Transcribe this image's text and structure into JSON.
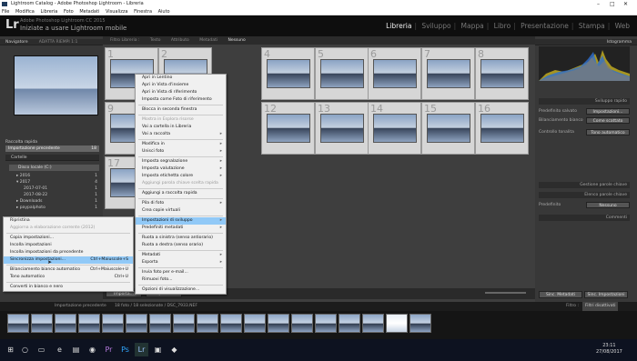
{
  "window": {
    "title": "Lightroom Catalog - Adobe Photoshop Lightroom - Libreria"
  },
  "menubar": [
    "File",
    "Modifica",
    "Libreria",
    "Foto",
    "Metadati",
    "Visualizza",
    "Finestra",
    "Aiuto"
  ],
  "identity": {
    "logo": "Lr",
    "catalog": "Adobe Photoshop Lightroom CC 2015",
    "sync": "Iniziate a usare Lightroom mobile"
  },
  "modules": [
    "Libreria",
    "Sviluppo",
    "Mappa",
    "Libro",
    "Presentazione",
    "Stampa",
    "Web"
  ],
  "left": {
    "navigator": "Navigatore",
    "nav_opts": "ADATTA  RIEMPI  1:1",
    "collection": "Raccolta rapida",
    "import": "Importazione precedente",
    "import_count": "18",
    "catalog": "Cartelle",
    "folders": [
      {
        "name": "2016",
        "count": "1"
      },
      {
        "name": "2017",
        "count": "4"
      },
      {
        "name": "2017-07-01",
        "count": "1"
      },
      {
        "name": "2017-08-22",
        "count": "1"
      },
      {
        "name": "Downloads",
        "count": "1"
      },
      {
        "name": "paypalphoto",
        "count": "1"
      }
    ]
  },
  "filter": {
    "label": "Filtro Libreria :",
    "tabs": [
      "Testo",
      "Attributo",
      "Metadati",
      "Nessuno"
    ]
  },
  "grid": {
    "numbers": [
      "1",
      "2",
      "3",
      "4",
      "5",
      "6",
      "7",
      "8",
      "9",
      "10",
      "11",
      "12",
      "13",
      "14",
      "15",
      "16",
      "17"
    ]
  },
  "context_menu": {
    "items": [
      "Apri in Lentino",
      "Apri in Vista d'insieme",
      "Apri in Vista di riferimento",
      "Imposta come Foto di riferimento",
      "Blocca in seconda finestra",
      "Mostra in Esplora risorse",
      "Vai a cartella in Libreria",
      "Vai a raccolta",
      "Modifica in",
      "Unisci foto",
      "Imposta segnalazione",
      "Imposta valutazione",
      "Imposta etichetta colore",
      "Aggiungi parola chiave scelta rapida",
      "Aggiungi a raccolta rapida",
      "Pila di foto",
      "Crea copie virtuali",
      "Impostazioni di sviluppo",
      "Predefiniti metadati",
      "Ruota a sinistra (senso antiorario)",
      "Ruota a destra (senso orario)",
      "Metadati",
      "Esporta",
      "Invia foto per e-mail...",
      "Rimuovi foto...",
      "Opzioni di visualizzazione..."
    ],
    "highlighted": "Impostazioni di sviluppo"
  },
  "sub_menu": {
    "items": [
      "Ripristina",
      "Aggiorna a elaborazione corrente (2012)",
      "Copia impostazioni...",
      "Incolla impostazioni",
      "Incolla impostazioni da precedente",
      "Sincronizza impostazioni...",
      "Bilanciamento bianco automatico",
      "Tono automatico",
      "Converti in bianco e nero"
    ],
    "shortcuts": {
      "sync": "Ctrl+Maiuscole+S",
      "wb": "Ctrl+Maiuscole+U",
      "tone": "Ctrl+U"
    },
    "highlighted": "Sincronizza impostazioni..."
  },
  "right": {
    "histogram": "Istogramma",
    "quick_dev": "Sviluppo rapido",
    "preset_label": "Predefinito salvato",
    "preset_val": "Impostazioni...",
    "wb_label": "Bilanciamento bianco",
    "wb_val": "Come scattato",
    "tone_label": "Controllo tonalita",
    "tone_val": "Tono automatico",
    "keywords": "Gestione parole chiave",
    "keyword_list": "Elenco parole chiave",
    "metadata": "Metadati",
    "comments": "Commenti",
    "predef": "Predefinito",
    "predef_val": "Nessuno",
    "sync_meta": "Sinc. Metadati",
    "sync_settings": "Sinc. Impostazioni"
  },
  "toolbar": {
    "import": "Importa...",
    "export": "Esporta...",
    "sort": "Miniature",
    "add": "Aggiungi"
  },
  "filmstrip": {
    "source": "Importazione precedente",
    "count": "18 foto / 18 selezionate / DSC_7933.NEF",
    "filter": "Filtro :",
    "filter_val": "Filtri disattivati"
  },
  "taskbar": {
    "time": "23:11",
    "date": "27/08/2017"
  }
}
